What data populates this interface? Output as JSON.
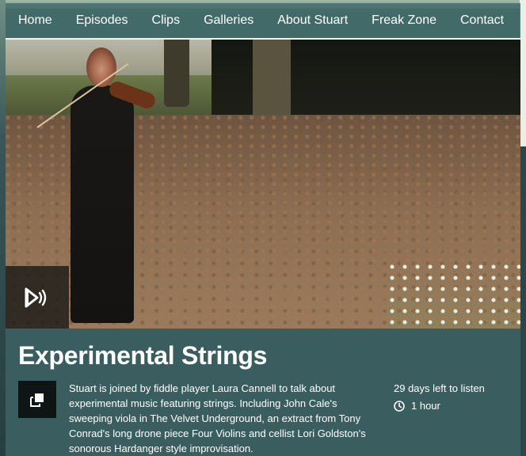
{
  "nav": {
    "items": [
      {
        "label": "Home"
      },
      {
        "label": "Episodes"
      },
      {
        "label": "Clips"
      },
      {
        "label": "Galleries"
      },
      {
        "label": "About Stuart"
      },
      {
        "label": "Freak Zone"
      },
      {
        "label": "Contact"
      }
    ]
  },
  "hero": {
    "audio_icon": "audio-play-icon"
  },
  "episode": {
    "title": "Experimental Strings",
    "description": "Stuart is joined by fiddle player Laura Cannell to talk about experimental music featuring strings. Including John Cale's sweeping viola in The Velvet Underground, an extract from Tony Conrad's long drone piece Four Violins and cellist Lori Goldston's sonorous Hardanger style improvisation.",
    "availability": "29 days left to listen",
    "duration": "1 hour",
    "popout_icon": "popout-player-icon",
    "clock_icon": "clock-icon"
  },
  "colors": {
    "nav_bg": "#466e6c",
    "panel_bg": "#3a5d5f",
    "text": "#ffffff"
  }
}
